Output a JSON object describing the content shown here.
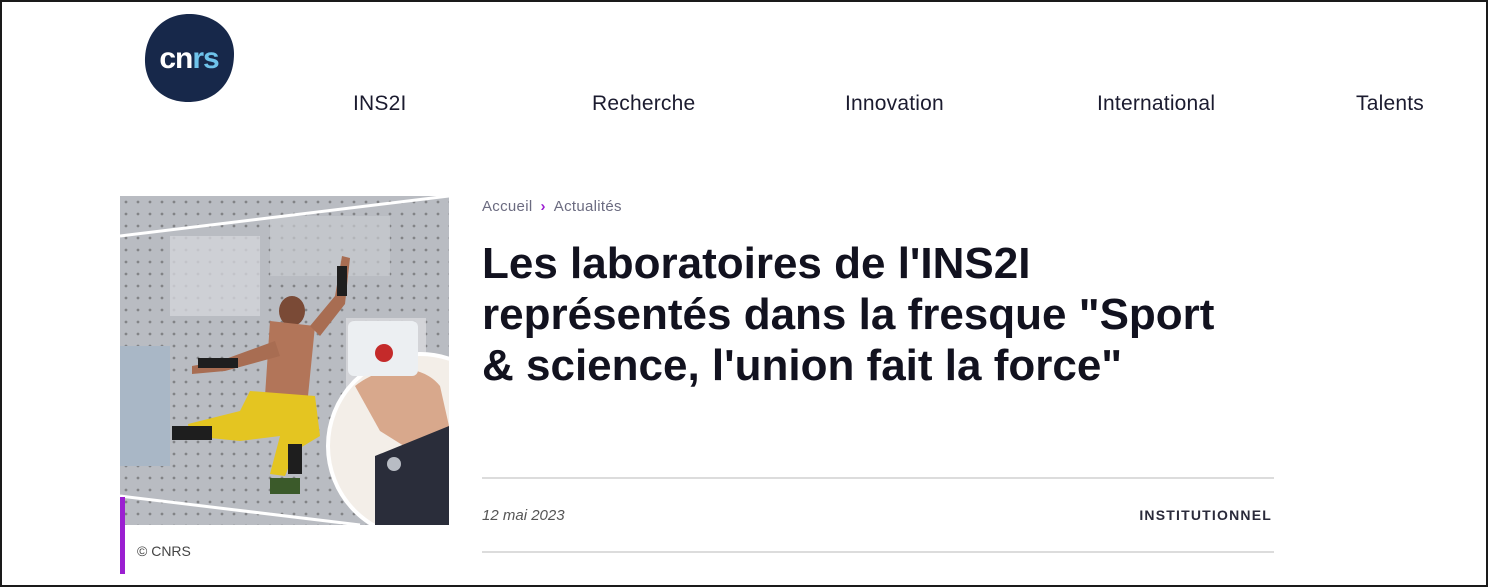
{
  "logo": {
    "part1": "cn",
    "part2": "rs"
  },
  "nav": {
    "items": [
      {
        "label": "INS2I"
      },
      {
        "label": "Recherche"
      },
      {
        "label": "Innovation"
      },
      {
        "label": "International"
      },
      {
        "label": "Talents"
      }
    ]
  },
  "breadcrumb": {
    "home": "Accueil",
    "separator": "›",
    "current": "Actualités"
  },
  "article": {
    "title": "Les laboratoires de l'INS2I représentés dans la fresque \"Sport & science, l'union fait la force\"",
    "date": "12 mai 2023",
    "category": "INSTITUTIONNEL",
    "image_credit": "© CNRS"
  },
  "colors": {
    "accent": "#9b1fd1",
    "logo_bg": "#17284a",
    "logo_light": "#6fc3ea"
  }
}
